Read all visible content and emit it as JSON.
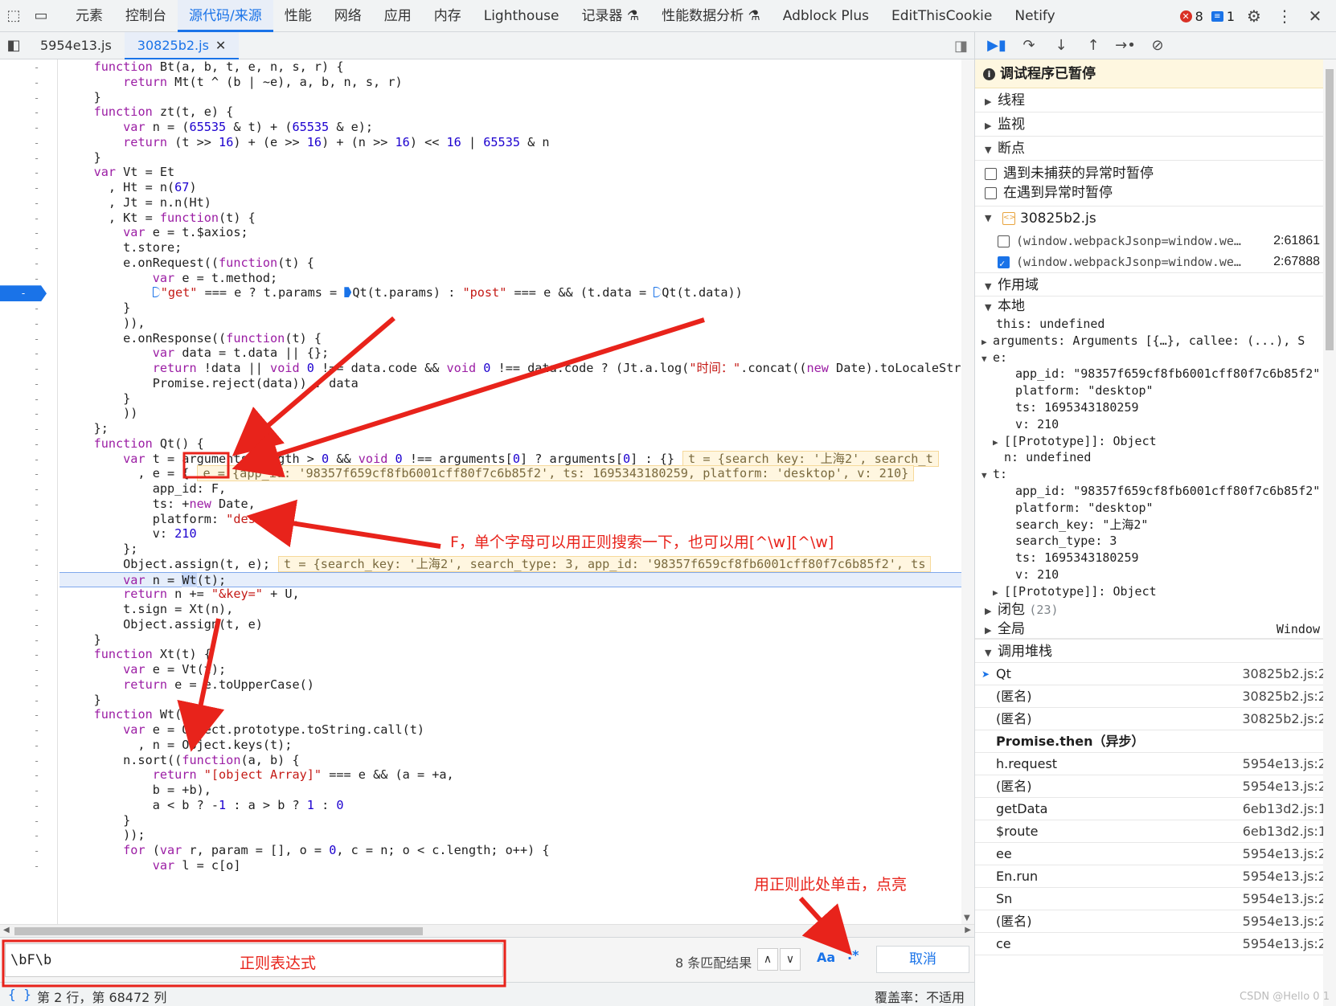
{
  "top_tabs": [
    "元素",
    "控制台",
    "源代码/来源",
    "性能",
    "网络",
    "应用",
    "内存",
    "Lighthouse",
    "记录器 ⚗",
    "性能数据分析 ⚗",
    "Adblock Plus",
    "EditThisCookie",
    "Netify"
  ],
  "top_active_tab": "源代码/来源",
  "error_count": "8",
  "message_count": "1",
  "file_tabs": [
    "5954e13.js",
    "30825b2.js"
  ],
  "code_lines": [
    {
      "y": 8,
      "html": "    <span class=\"kw\">function</span> Bt(a, b, t, e, n, s, r) {"
    },
    {
      "y": 1,
      "html": "        <span class=\"kw\">return</span> Mt(t ^ (b | ~e), a, b, n, s, r)"
    },
    {
      "y": 2,
      "html": "    }"
    },
    {
      "y": 3,
      "html": "    <span class=\"kw\">function</span> zt(t, e) {"
    },
    {
      "y": 4,
      "html": "        <span class=\"kw\">var</span> n = (<span class=\"num\">65535</span> &amp; t) + (<span class=\"num\">65535</span> &amp; e);"
    },
    {
      "y": 5,
      "html": "        <span class=\"kw\">return</span> (t &gt;&gt; <span class=\"num\">16</span>) + (e &gt;&gt; <span class=\"num\">16</span>) + (n &gt;&gt; <span class=\"num\">16</span>) &lt;&lt; <span class=\"num\">16</span> | <span class=\"num\">65535</span> &amp; n"
    },
    {
      "y": 6,
      "html": "    }"
    },
    {
      "y": 7,
      "html": "    <span class=\"kw\">var</span> Vt = Et"
    }
  ],
  "code": [
    "    function Bt(a, b, t, e, n, s, r) {",
    "        return Mt(t ^ (b | ~e), a, b, n, s, r)",
    "    }",
    "    function zt(t, e) {",
    "        var n = (65535 & t) + (65535 & e);",
    "        return (t >> 16) + (e >> 16) + (n >> 16) << 16 | 65535 & n",
    "    }",
    "    var Vt = Et",
    "      , Ht = n(67)",
    "      , Jt = n.n(Ht)",
    "      , Kt = function(t) {",
    "        var e = t.$axios;",
    "        t.store;",
    "        e.onRequest((function(t) {",
    "            var e = t.method;",
    "            \"get\" === e ? t.params = Qt(t.params) : \"post\" === e && (t.data = Qt(t.data))",
    "        }",
    "        )),",
    "        e.onResponse((function(t) {",
    "            var data = t.data || {};",
    "            return !data || void 0 !== data.code && void 0 !== data.code ? (Jt.a.log(\"时间：\".concat((new Date).toLocaleStri",
    "            Promise.reject(data)) : data",
    "        }",
    "        ))",
    "    };",
    "    function Qt() {",
    "        var t = arguments.length > 0 && void 0 !== arguments[0] ? arguments[0] : {}",
    "          , e = {",
    "            app_id: F,",
    "            ts: +new Date,",
    "            platform: \"desktop\",",
    "            v: 210",
    "        };",
    "        Object.assign(t, e);",
    "        var n = Wt(t);",
    "        return n += \"&key=\" + U,",
    "        t.sign = Xt(n),",
    "        Object.assign(t, e)",
    "    }",
    "    function Xt(t) {",
    "        var e = Vt(t);",
    "        return e = e.toUpperCase()",
    "    }",
    "    function Wt(t) {",
    "        var e = Object.prototype.toString.call(t)",
    "          , n = Object.keys(t);",
    "        n.sort((function(a, b) {",
    "            return \"[object Array]\" === e && (a = +a,",
    "            b = +b),",
    "            a < b ? -1 : a > b ? 1 : 0",
    "        }",
    "        ));",
    "        for (var r, param = [], o = 0, c = n; o < c.length; o++) {",
    "            var l = c[o]"
  ],
  "inline_values": {
    "qt_t": "t = {search_key: '上海2', search_t",
    "qt_e": "e = {app_id: '98357f659cf8fb6001cff80f7c6b85f2', ts: 1695343180259, platform: 'desktop', v: 210}",
    "assign_t": "t = {search_key: '上海2', search_type: 3, app_id: '98357f659cf8fb6001cff80f7c6b85f2', ts"
  },
  "search": {
    "query": "\\bF\\b",
    "result_count": "8 条匹配结果",
    "case_label": "Aa",
    "regex_label": ".*",
    "cancel_label": "取消"
  },
  "status": {
    "position": "第 2 行，第 68472 列",
    "coverage": "覆盖率：不适用"
  },
  "debugger": {
    "paused_label": "调试程序已暂停",
    "threads": "线程",
    "watch": "监视",
    "breakpoints": "断点",
    "pause_uncaught": "遇到未捕获的异常时暂停",
    "pause_caught": "在遇到异常时暂停",
    "bp_file": "30825b2.js",
    "bp_entries": [
      {
        "code": "(window.webpackJsonp=window.we…",
        "loc": "2:61861",
        "checked": false
      },
      {
        "code": "(window.webpackJsonp=window.we…",
        "loc": "2:67888",
        "checked": true
      }
    ],
    "scope": "作用域",
    "local": "本地",
    "closure": "闭包",
    "closure_count": "(23)",
    "global": "全局",
    "global_value": "Window",
    "call_stack": "调用堆栈",
    "frames": [
      {
        "name": "Qt",
        "loc": "30825b2.js:2",
        "current": true
      },
      {
        "name": "(匿名)",
        "loc": "30825b2.js:2"
      },
      {
        "name": "(匿名)",
        "loc": "30825b2.js:2"
      },
      {
        "async": "Promise.then（异步）"
      },
      {
        "name": "h.request",
        "loc": "5954e13.js:2"
      },
      {
        "name": "(匿名)",
        "loc": "5954e13.js:2"
      },
      {
        "name": "getData",
        "loc": "6eb13d2.js:1"
      },
      {
        "name": "$route",
        "loc": "6eb13d2.js:1"
      },
      {
        "name": "ee",
        "loc": "5954e13.js:2"
      },
      {
        "name": "En.run",
        "loc": "5954e13.js:2"
      },
      {
        "name": "Sn",
        "loc": "5954e13.js:2"
      },
      {
        "name": "(匿名)",
        "loc": "5954e13.js:2"
      },
      {
        "name": "ce",
        "loc": "5954e13.js:2"
      }
    ]
  },
  "scope_lines": [
    "this: undefined",
    "arguments: Arguments [{…}, callee: (...), S",
    "e:",
    "app_id: \"98357f659cf8fb6001cff80f7c6b85f2\"",
    "platform: \"desktop\"",
    "ts: 1695343180259",
    "v: 210",
    "[[Prototype]]: Object",
    "n: undefined",
    "t:",
    "app_id: \"98357f659cf8fb6001cff80f7c6b85f2\"",
    "platform: \"desktop\"",
    "search_key: \"上海2\"",
    "search_type: 3",
    "ts: 1695343180259",
    "v: 210",
    "[[Prototype]]: Object"
  ],
  "annotations": {
    "f_note": "F，单个字母可以用正则搜索一下，也可以用[^\\w][^\\w]",
    "regex_note": "正则表达式",
    "click_note": "用正则此处单击，点亮"
  },
  "watermark": "CSDN @Hello 0 1"
}
